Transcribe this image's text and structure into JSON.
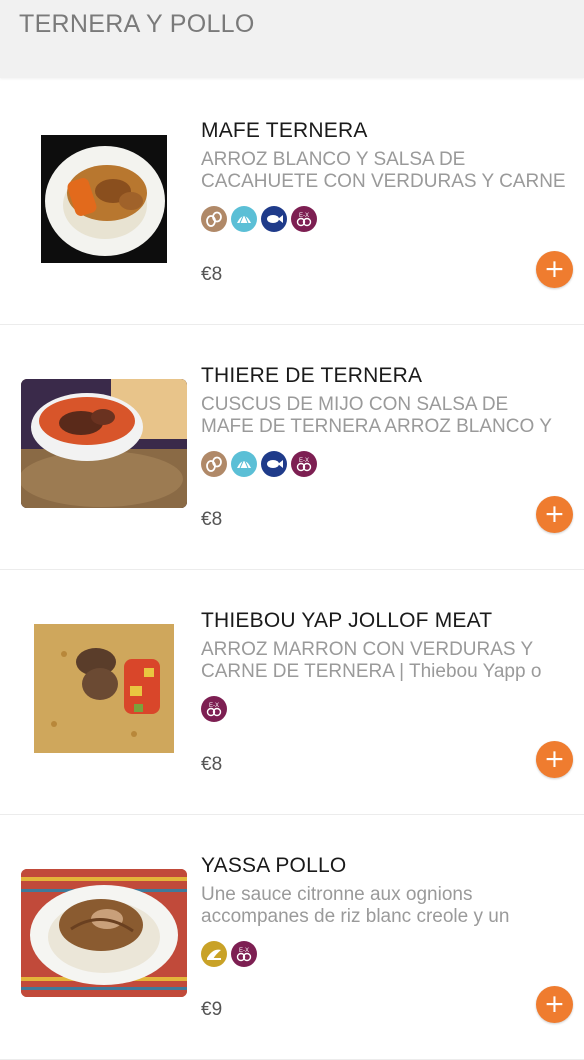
{
  "section_title": "TERNERA Y POLLO",
  "colors": {
    "accent": "#ef7c2f",
    "allergen_peanut": "#b08968",
    "allergen_mollusc": "#5bbfd6",
    "allergen_fish": "#1f3b8a",
    "allergen_eggs": "#7d1f52",
    "allergen_mustard": "#c9a227"
  },
  "add_label": "+",
  "items": [
    {
      "name": "MAFE TERNERA",
      "desc": [
        "ARROZ BLANCO Y SALSA DE",
        "CACAHUETE CON VERDURAS Y CARNE"
      ],
      "price": "€8",
      "allergens": [
        "peanut-icon",
        "mollusc-icon",
        "fish-icon",
        "eggs-icon"
      ]
    },
    {
      "name": "THIERE DE TERNERA",
      "desc": [
        "CUSCUS DE MIJO CON SALSA DE",
        "MAFE DE TERNERA ARROZ BLANCO Y"
      ],
      "price": "€8",
      "allergens": [
        "peanut-icon",
        "mollusc-icon",
        "fish-icon",
        "eggs-icon"
      ]
    },
    {
      "name": "THIEBOU YAP JOLLOF MEAT",
      "desc": [
        "ARROZ MARRON CON VERDURAS Y",
        "CARNE DE TERNERA | Thiebou Yapp o"
      ],
      "price": "€8",
      "allergens": [
        "eggs-icon"
      ]
    },
    {
      "name": "YASSA POLLO",
      "desc": [
        "Une sauce citronne aux ognions",
        "accompanes de riz blanc creole y un"
      ],
      "price": "€9",
      "allergens": [
        "mustard-icon",
        "eggs-icon"
      ]
    }
  ]
}
